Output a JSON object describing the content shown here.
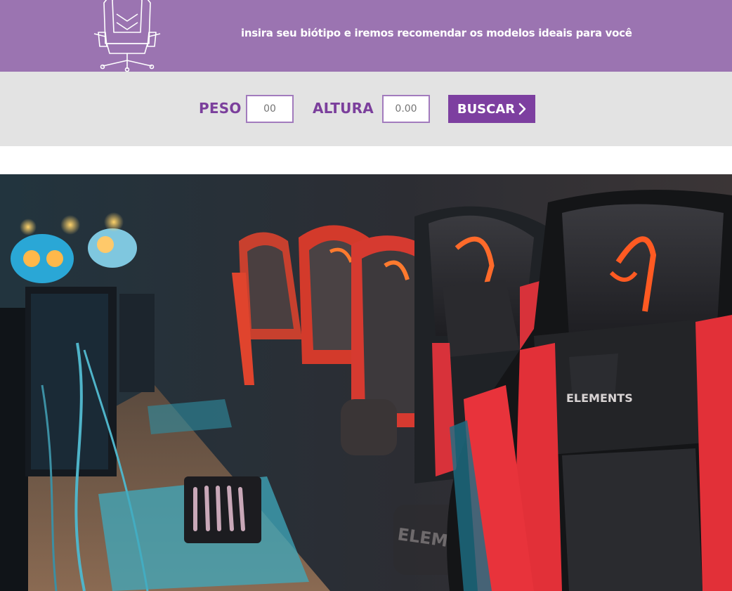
{
  "header": {
    "tagline": "insira seu biótipo e iremos recomendar os modelos ideais para você",
    "logo_icon": "gaming-chair-icon"
  },
  "search": {
    "peso_label": "PESO",
    "peso_placeholder": "00",
    "altura_label": "ALTURA",
    "altura_placeholder": "0.00",
    "button_label": "BUSCAR",
    "button_icon": "chevron-right-icon"
  },
  "hero": {
    "chair_brand_text": "ELEMENTS",
    "image_alt": "gaming-chairs-photo"
  },
  "colors": {
    "banner": "#9b74b1",
    "accent": "#7d3fa0",
    "search_bg": "#e3e3e3"
  }
}
